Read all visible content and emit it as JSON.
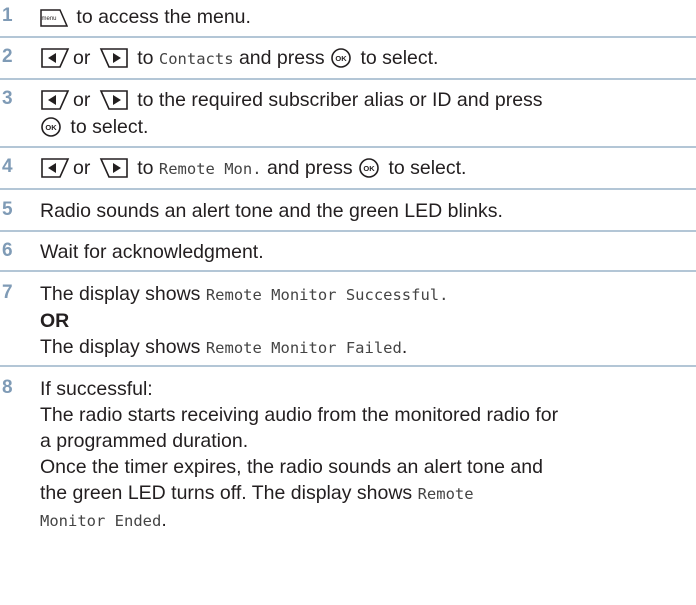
{
  "steps": [
    {
      "number": "1",
      "key_menu_label": "menu",
      "text_after": "to access the menu."
    },
    {
      "number": "2",
      "or": "or",
      "text_to": "to",
      "menu_item": "Contacts",
      "text_press": "and press",
      "text_select": "to select."
    },
    {
      "number": "3",
      "or": "or",
      "line1_text": "to the required subscriber alias or ID and press",
      "text_select": "to select."
    },
    {
      "number": "4",
      "or": "or",
      "text_to": "to",
      "menu_item": "Remote Mon.",
      "text_press": "and press",
      "text_select": "to select."
    },
    {
      "number": "5",
      "text": "Radio sounds an alert tone and the green LED blinks."
    },
    {
      "number": "6",
      "text": "Wait for acknowledgment."
    },
    {
      "number": "7",
      "line1_prefix": "The display shows",
      "line1_display": "Remote Monitor Successful.",
      "or_label": "OR",
      "line3_prefix": "The display shows",
      "line3_display": "Remote Monitor Failed",
      "line3_suffix": "."
    },
    {
      "number": "8",
      "line1": "If successful:",
      "line2": "The radio starts receiving audio from the monitored radio for",
      "line3": "a programmed duration.",
      "line4": "Once the timer expires, the radio sounds an alert tone and",
      "line5_prefix": "the green LED turns off. The display shows",
      "line5_display": "Remote",
      "line6_display": "Monitor Ended",
      "line6_suffix": "."
    }
  ]
}
